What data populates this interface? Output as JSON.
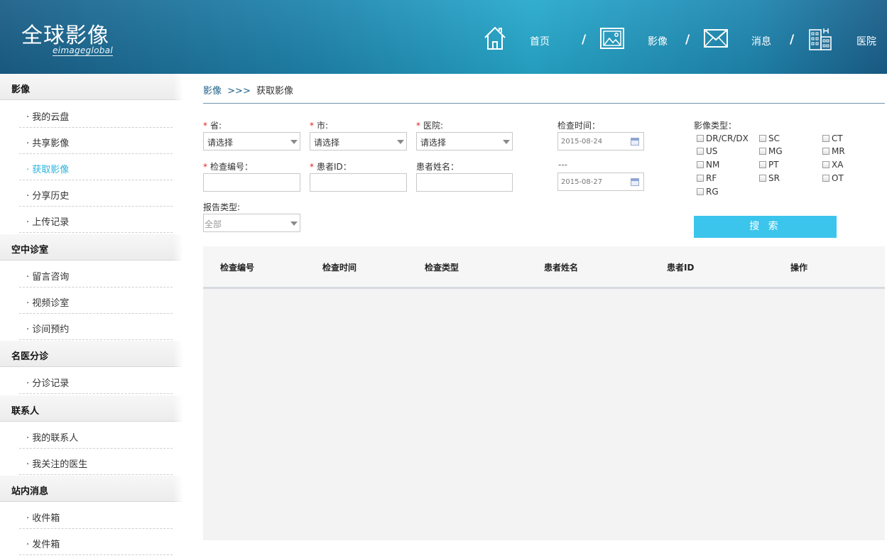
{
  "header": {
    "logo_main": "全球影像",
    "logo_sub": "eimageglobal",
    "nav": [
      {
        "label": "首页",
        "icon": "home-icon"
      },
      {
        "label": "影像",
        "icon": "image-icon"
      },
      {
        "label": "消息",
        "icon": "mail-icon"
      },
      {
        "label": "医院",
        "icon": "hospital-icon"
      }
    ],
    "separator": "/"
  },
  "sidebar": {
    "groups": [
      {
        "label": "影像",
        "items": [
          "· 我的云盘",
          "· 共享影像",
          "· 获取影像",
          "· 分享历史",
          "· 上传记录"
        ]
      },
      {
        "label": "空中诊室",
        "items": [
          "· 留言咨询",
          "· 视频诊室",
          "· 诊间预约"
        ]
      },
      {
        "label": "名医分诊",
        "items": [
          "· 分诊记录"
        ]
      },
      {
        "label": "联系人",
        "items": [
          "· 我的联系人",
          "· 我关注的医生"
        ]
      },
      {
        "label": "站内消息",
        "items": [
          "· 收件箱",
          "· 发件箱"
        ]
      }
    ],
    "active_item": "· 获取影像"
  },
  "breadcrumb": {
    "parent": "影像",
    "separator": ">>>",
    "current": "获取影像"
  },
  "form": {
    "required_mark": "*",
    "province": {
      "label": "省:",
      "value": "请选择"
    },
    "city": {
      "label": "市:",
      "value": "请选择"
    },
    "hospital": {
      "label": "医院:",
      "value": "请选择"
    },
    "exam_no": {
      "label": "检查编号：",
      "value": ""
    },
    "patient_id": {
      "label": "患者ID：",
      "value": ""
    },
    "patient_name": {
      "label": "患者姓名：",
      "value": ""
    },
    "report_type": {
      "label": "报告类型:",
      "value": "全部"
    },
    "exam_time": {
      "label": "检查时间：",
      "from": "2015-08-24",
      "range_sep": "---",
      "to": "2015-08-27"
    },
    "image_type": {
      "label": "影像类型：",
      "options": [
        "DR/CR/DX",
        "SC",
        "CT",
        "US",
        "MG",
        "MR",
        "NM",
        "PT",
        "XA",
        "RF",
        "SR",
        "OT",
        "RG"
      ]
    },
    "search_label": "搜 索"
  },
  "table": {
    "columns": [
      "检查编号",
      "检查时间",
      "检查类型",
      "患者姓名",
      "患者ID",
      "操作"
    ],
    "rows": []
  },
  "colors": {
    "accent": "#3bc5ec",
    "active_nav": "#2bb4dd",
    "header_dark": "#1b5f88",
    "required": "#e02424"
  }
}
